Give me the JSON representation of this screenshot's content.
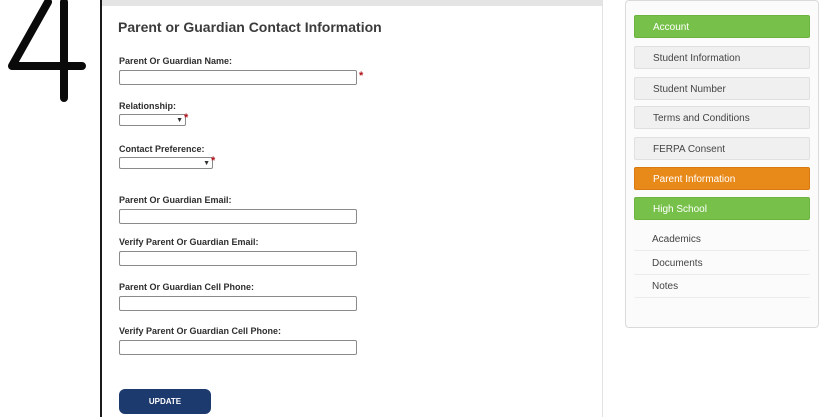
{
  "annotation": {
    "step_number": "4"
  },
  "form": {
    "title": "Parent or Guardian Contact Information",
    "fields": {
      "guardian_name": {
        "label": "Parent Or Guardian Name:",
        "value": "",
        "required": "*"
      },
      "relationship": {
        "label": "Relationship:",
        "value": "",
        "required": "*"
      },
      "contact_preference": {
        "label": "Contact Preference:",
        "value": "",
        "required": "*"
      },
      "guardian_email": {
        "label": "Parent Or Guardian Email:",
        "value": ""
      },
      "verify_email": {
        "label": "Verify Parent Or Guardian Email:",
        "value": ""
      },
      "cell_phone": {
        "label": "Parent Or Guardian Cell Phone:",
        "value": ""
      },
      "verify_cell_phone": {
        "label": "Verify Parent Or Guardian Cell Phone:",
        "value": ""
      }
    },
    "update_label": "UPDATE"
  },
  "sidebar": {
    "items": [
      {
        "label": "Account",
        "state": "complete"
      },
      {
        "label": "Student Information",
        "state": "default"
      },
      {
        "label": "Student Number",
        "state": "default"
      },
      {
        "label": "Terms and Conditions",
        "state": "default"
      },
      {
        "label": "FERPA Consent",
        "state": "default"
      },
      {
        "label": "Parent Information",
        "state": "active"
      },
      {
        "label": "High School",
        "state": "complete"
      },
      {
        "label": "Academics",
        "state": "default"
      },
      {
        "label": "Documents",
        "state": "default"
      },
      {
        "label": "Notes",
        "state": "default"
      }
    ]
  },
  "colors": {
    "complete": "#77c14a",
    "active": "#e88a1a",
    "button": "#1d3a6e",
    "required": "#b0121b"
  }
}
